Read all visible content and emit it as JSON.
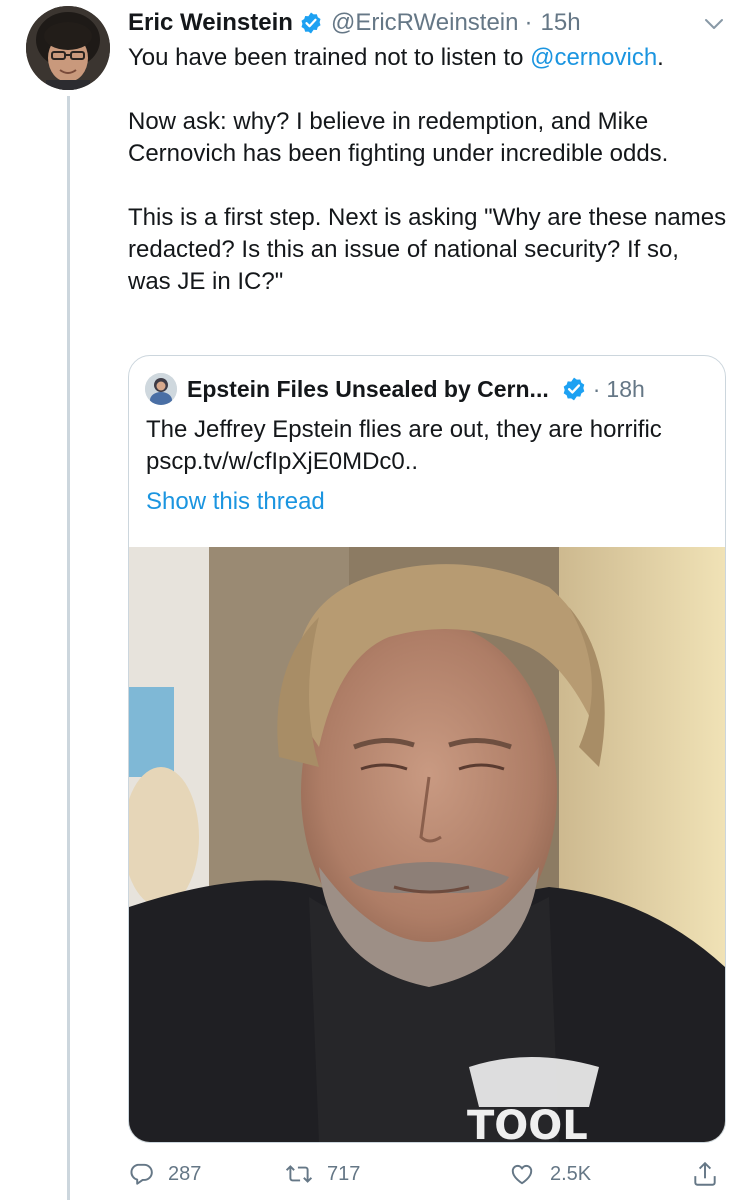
{
  "tweet": {
    "author_name": "Eric Weinstein",
    "author_handle": "@EricRWeinstein",
    "separator": "·",
    "time": "15h",
    "text_line1_pre": "You have been trained not to listen to ",
    "text_line1_mention": "@cernovich",
    "text_line1_post": ".",
    "paragraph2": "Now ask: why? I believe in redemption, and Mike Cernovich has been fighting under incredible odds.",
    "paragraph3": "This is a first step. Next is asking \"Why are these names redacted? Is this an issue of national security? If so, was JE in IC?\""
  },
  "quote": {
    "author_name": "Epstein Files Unsealed by Cern...",
    "separator": "·",
    "time": "18h",
    "text": "The Jeffrey Epstein flies are out, they are horrific pscp.tv/w/cfIpXjE0MDc0..",
    "show_thread_label": "Show this thread",
    "media_shirt_logo_text": "TOOL"
  },
  "actions": {
    "reply_count": "287",
    "retweet_count": "717",
    "like_count": "2.5K"
  },
  "colors": {
    "link_blue": "#1b95e0",
    "verified_blue": "#1da1f2",
    "secondary_gray": "#657786",
    "border_gray": "#ccd6dd"
  },
  "icons": {
    "verified": "verified-badge-icon",
    "caret": "chevron-down-icon",
    "reply": "reply-icon",
    "retweet": "retweet-icon",
    "like": "heart-icon",
    "share": "share-icon"
  }
}
